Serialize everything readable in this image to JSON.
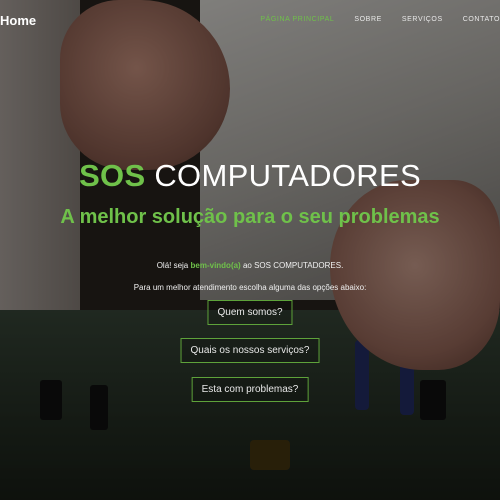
{
  "nav": {
    "brand": "Home",
    "items": [
      {
        "label": "PÁGINA PRINCIPAL",
        "active": true
      },
      {
        "label": "SOBRE",
        "active": false
      },
      {
        "label": "SERVIÇOS",
        "active": false
      },
      {
        "label": "CONTATO",
        "active": false
      }
    ]
  },
  "hero": {
    "title_accent": "SOS",
    "title_rest": "COMPUTADORES",
    "subtitle": "A melhor solução para o seu problemas",
    "welcome_pre": "Olá! seja",
    "welcome_highlight": "bem-vindo(a)",
    "welcome_post": "ao SOS COMPUTADORES.",
    "choose": "Para um melhor atendimento escolha alguma das opções abaixo:"
  },
  "buttons": {
    "about": "Quem somos?",
    "services": "Quais os nossos serviços?",
    "problems": "Esta com problemas?"
  },
  "colors": {
    "accent": "#6fc14a"
  }
}
